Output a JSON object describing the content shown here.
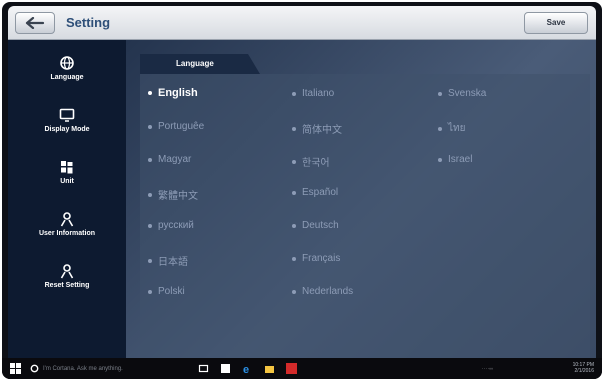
{
  "header": {
    "title": "Setting",
    "save_label": "Save"
  },
  "sidebar": {
    "items": [
      {
        "label": "Language",
        "icon": "globe-icon"
      },
      {
        "label": "Display Mode",
        "icon": "monitor-icon"
      },
      {
        "label": "Unit",
        "icon": "unit-icon"
      },
      {
        "label": "User Information",
        "icon": "user-icon"
      },
      {
        "label": "Reset Setting",
        "icon": "reset-user-icon"
      }
    ]
  },
  "main": {
    "tab_label": "Language",
    "languages": [
      {
        "label": "English",
        "selected": true
      },
      {
        "label": "Portuguêe",
        "selected": false
      },
      {
        "label": "Magyar",
        "selected": false
      },
      {
        "label": "繁體中文",
        "selected": false
      },
      {
        "label": "русский",
        "selected": false
      },
      {
        "label": "日本語",
        "selected": false
      },
      {
        "label": "Polski",
        "selected": false
      },
      {
        "label": "Italiano",
        "selected": false
      },
      {
        "label": "简体中文",
        "selected": false
      },
      {
        "label": "한국어",
        "selected": false
      },
      {
        "label": "Español",
        "selected": false
      },
      {
        "label": "Deutsch",
        "selected": false
      },
      {
        "label": "Français",
        "selected": false
      },
      {
        "label": "Nederlands",
        "selected": false
      },
      {
        "label": "Svenska",
        "selected": false
      },
      {
        "label": "ไทย",
        "selected": false
      },
      {
        "label": "Israel",
        "selected": false
      }
    ]
  },
  "taskbar": {
    "search_placeholder": "I'm Cortana. Ask me anything.",
    "time": "10:17 PM",
    "date": "2/1/2016"
  },
  "colors": {
    "title": "#2e4f78",
    "selected": "#ffffff",
    "unselected": "#8d9cb6",
    "sidebar": "#0d1a30"
  }
}
